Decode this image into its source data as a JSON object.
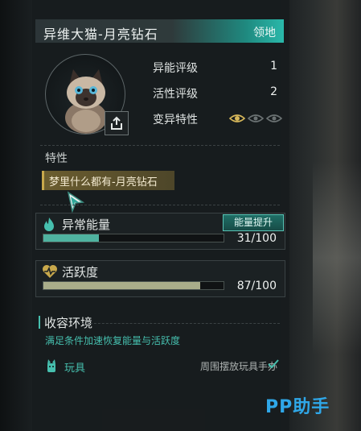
{
  "header": {
    "name": "异维大猫-月亮钻石",
    "tag": "领地"
  },
  "stats": [
    {
      "label": "异能评级",
      "value": "1"
    },
    {
      "label": "活性评级",
      "value": "2"
    },
    {
      "label": "变异特性",
      "value": ""
    }
  ],
  "mutation_level": {
    "active": 1,
    "total": 3
  },
  "trait": {
    "section_label": "特性",
    "name": "梦里什么都有-月亮钻石"
  },
  "energy": {
    "title": "异常能量",
    "value_text": "31/100",
    "fraction": 0.31,
    "boost_label": "能量提升",
    "fill_color": "#4fb3a0"
  },
  "activity": {
    "title": "活跃度",
    "value_text": "87/100",
    "fraction": 0.87,
    "fill_color": "#a9ad8a"
  },
  "containment": {
    "title": "收容环境",
    "description": "满足条件加速恢复能量与活跃度",
    "toy_label": "玩具",
    "toy_requirement": "周围摆放玩具手办"
  },
  "watermark": "PP助手",
  "colors": {
    "accent": "#46bfae",
    "trait_gold": "#c8a84b",
    "brand": "#2fa7e8"
  }
}
